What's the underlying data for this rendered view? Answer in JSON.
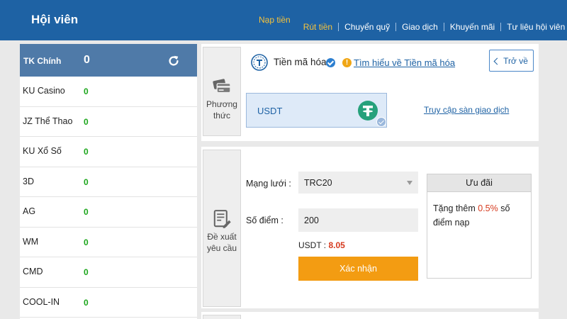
{
  "header": {
    "title": "Hội viên",
    "nav": [
      {
        "label": "Nạp tiền"
      },
      {
        "label": "Rút tiền"
      },
      {
        "label": "Chuyển quỹ"
      },
      {
        "label": "Giao dịch"
      },
      {
        "label": "Khuyến mãi"
      },
      {
        "label": "Tư liệu hội viên"
      }
    ]
  },
  "sidebar": {
    "main_account": {
      "label": "TK Chính",
      "balance": "0",
      "icon": "refresh-icon"
    },
    "items": [
      {
        "label": "KU Casino",
        "value": "0"
      },
      {
        "label": "JZ Thể Thao",
        "value": "0"
      },
      {
        "label": "KU Xổ Số",
        "value": "0"
      },
      {
        "label": "3D",
        "value": "0"
      },
      {
        "label": "AG",
        "value": "0"
      },
      {
        "label": "WM",
        "value": "0"
      },
      {
        "label": "CMD",
        "value": "0"
      },
      {
        "label": "COOL-IN",
        "value": "0"
      }
    ]
  },
  "method_panel": {
    "side_label": "Phương\nthức",
    "title": "Tiền mã hóa",
    "learn_link": "Tìm hiểu về Tiền mã hóa",
    "back_button": "Trở về",
    "selected_coin": "USDT",
    "exchange_link": "Truy cập sàn giao dịch"
  },
  "request_panel": {
    "side_label": "Đề xuất\nyêu cầu",
    "network_label": "Mạng lưới :",
    "network_value": "TRC20",
    "points_label": "Số điểm :",
    "points_value": "200",
    "usdt_label": "USDT : ",
    "usdt_value": "8.05",
    "submit_button": "Xác nhận",
    "promo": {
      "title": "Ưu đãi",
      "text_before": "Tặng thêm ",
      "percent": "0.5%",
      "text_after": " số điểm nạp"
    }
  },
  "colors": {
    "header_bg": "#1e62a4",
    "nav_active": "#f5c23c",
    "sidebar_active_bg": "#4f7aa8",
    "balance_green": "#1aa51a",
    "button_orange": "#f39c12",
    "accent_red": "#d63a1e",
    "tether_green": "#26a17b"
  }
}
